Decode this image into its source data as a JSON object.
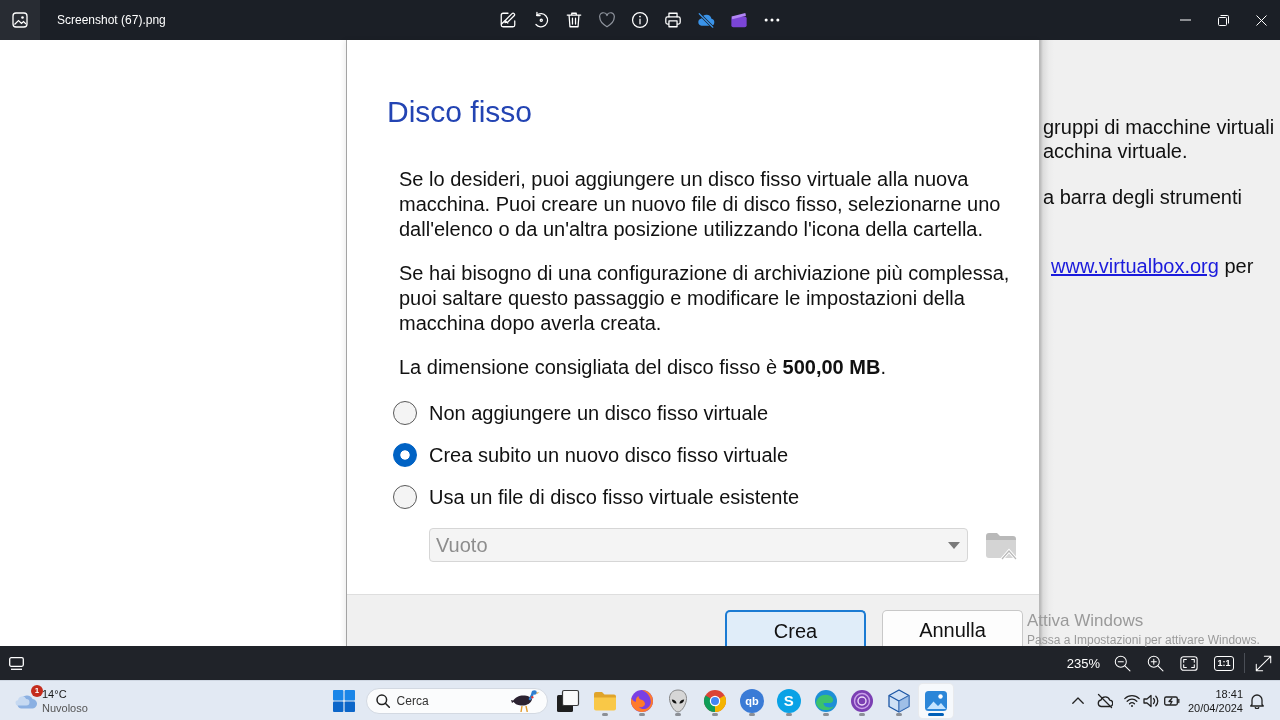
{
  "titlebar": {
    "title": "Screenshot (67).png"
  },
  "dialog": {
    "heading": "Disco fisso",
    "paragraphs": [
      "Se lo desideri, puoi aggiungere un disco fisso virtuale alla nuova macchina. Puoi creare un nuovo file di disco fisso, selezionarne uno dall'elenco o da un'altra posizione utilizzando l'icona della cartella.",
      "Se hai bisogno di una configurazione di archiviazione più complessa, puoi saltare questo passaggio e modificare le impostazioni della macchina dopo averla creata.",
      "La dimensione consigliata del disco fisso è **500,00 MB**."
    ],
    "options": [
      {
        "label": "Non aggiungere un disco fisso virtuale",
        "selected": false
      },
      {
        "label": "Crea subito un nuovo disco fisso virtuale",
        "selected": true
      },
      {
        "label": "Usa un file di disco fisso virtuale esistente",
        "selected": false
      }
    ],
    "disk_select": {
      "value": "Vuoto",
      "disabled": true
    },
    "buttons": [
      {
        "label": "Crea",
        "default": true
      },
      {
        "label": "Annulla",
        "default": false
      }
    ]
  },
  "background_panel": {
    "paragraphs": [
      {
        "lines": [
          {
            "text": "gruppi di macchine virtuali"
          },
          {
            "text": "acchina virtuale."
          }
        ]
      },
      {
        "lines": [
          {
            "text": "a barra degli strumenti"
          }
        ]
      },
      {
        "lines": [
          {
            "link": "www.virtualbox.org",
            "text": " per"
          }
        ]
      }
    ]
  },
  "watermark": {
    "title": "Attiva Windows",
    "subtitle": "Passa a Impostazioni per attivare Windows."
  },
  "viewer_bar": {
    "zoom": "235%",
    "actual_size": "1:1"
  },
  "taskbar": {
    "weather": {
      "badge": "1",
      "temperature": "14°C",
      "condition": "Nuvoloso"
    },
    "search": {
      "placeholder": "Cerca"
    },
    "apps": [
      {
        "kind": "window",
        "running": false,
        "selected": false
      },
      {
        "kind": "folder",
        "running": true,
        "selected": false
      },
      {
        "kind": "foxglobe",
        "running": true,
        "selected": false
      },
      {
        "kind": "alien",
        "running": true,
        "selected": false
      },
      {
        "kind": "wheel",
        "running": true,
        "selected": false
      },
      {
        "kind": "qdisc",
        "glyph": "qb",
        "running": true,
        "selected": false
      },
      {
        "kind": "sdisc",
        "glyph": "S",
        "running": true,
        "selected": false
      },
      {
        "kind": "wave",
        "running": true,
        "selected": false
      },
      {
        "kind": "orb",
        "running": true,
        "selected": false
      },
      {
        "kind": "cube",
        "running": true,
        "selected": false
      },
      {
        "kind": "picture",
        "running": true,
        "selected": true
      }
    ],
    "clock": {
      "time": "18:41",
      "date": "20/04/2024"
    }
  }
}
